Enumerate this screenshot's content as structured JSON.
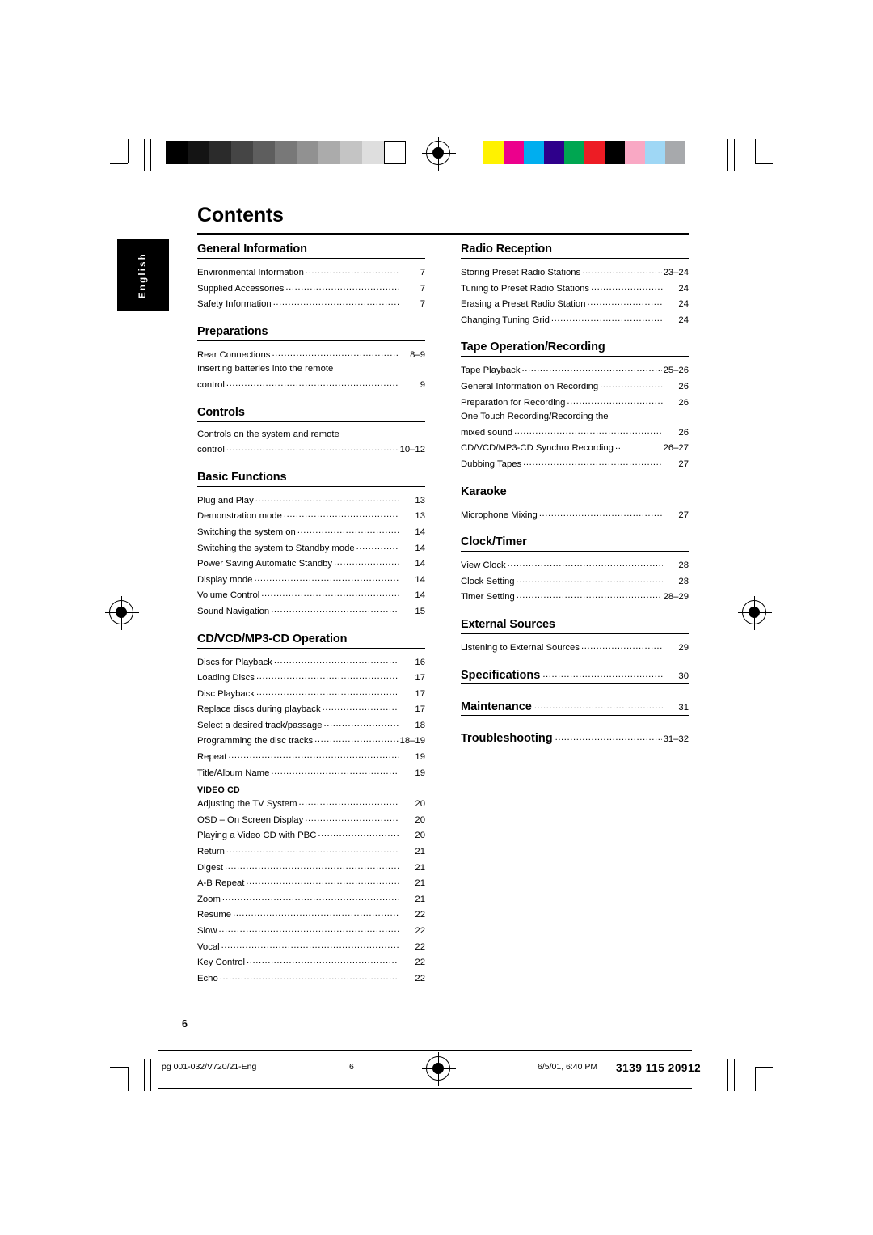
{
  "document": {
    "title": "Contents",
    "language_tab": "English",
    "page_number": "6"
  },
  "footer": {
    "file": "pg 001-032/V720/21-Eng",
    "page": "6",
    "date": "6/5/01, 6:40 PM",
    "code": "3139 115 20912"
  },
  "columns": {
    "left": [
      {
        "heading": "General Information",
        "entries": [
          {
            "text": "Environmental Information",
            "page": "7"
          },
          {
            "text": "Supplied Accessories",
            "page": "7"
          },
          {
            "text": "Safety Information",
            "page": "7"
          }
        ]
      },
      {
        "heading": "Preparations",
        "entries": [
          {
            "text": "Rear Connections",
            "page": "8–9"
          },
          {
            "text": "Inserting batteries into the remote",
            "page": "",
            "nodots": true
          },
          {
            "text": "control",
            "page": "9"
          }
        ]
      },
      {
        "heading": "Controls",
        "entries": [
          {
            "text": "Controls on the system and remote",
            "page": "",
            "nodots": true
          },
          {
            "text": "control",
            "page": "10–12"
          }
        ]
      },
      {
        "heading": "Basic Functions",
        "entries": [
          {
            "text": "Plug and Play",
            "page": "13"
          },
          {
            "text": "Demonstration mode",
            "page": "13"
          },
          {
            "text": "Switching the system on",
            "page": "14"
          },
          {
            "text": "Switching the system to Standby mode",
            "page": "14"
          },
          {
            "text": "Power Saving Automatic Standby",
            "page": "14"
          },
          {
            "text": "Display mode",
            "page": "14"
          },
          {
            "text": "Volume Control",
            "page": "14"
          },
          {
            "text": "Sound Navigation",
            "page": "15"
          }
        ]
      },
      {
        "heading": "CD/VCD/MP3-CD Operation",
        "entries": [
          {
            "text": "Discs for Playback",
            "page": "16"
          },
          {
            "text": "Loading Discs",
            "page": "17"
          },
          {
            "text": "Disc Playback",
            "page": "17"
          },
          {
            "text": "Replace discs during playback",
            "page": "17"
          },
          {
            "text": "Select a desired track/passage",
            "page": "18"
          },
          {
            "text": "Programming the disc tracks",
            "page": "18–19"
          },
          {
            "text": "Repeat",
            "page": "19"
          },
          {
            "text": "Title/Album Name",
            "page": "19"
          }
        ],
        "subhead": "VIDEO CD",
        "sub_entries": [
          {
            "text": "Adjusting the TV System",
            "page": "20"
          },
          {
            "text": "OSD – On Screen Display",
            "page": "20"
          },
          {
            "text": "Playing a Video CD with PBC",
            "page": "20"
          },
          {
            "text": "Return",
            "page": "21"
          },
          {
            "text": "Digest",
            "page": "21"
          },
          {
            "text": "A-B Repeat",
            "page": "21"
          },
          {
            "text": "Zoom",
            "page": "21"
          },
          {
            "text": "Resume",
            "page": "22"
          },
          {
            "text": "Slow",
            "page": "22"
          },
          {
            "text": "Vocal",
            "page": "22"
          },
          {
            "text": "Key Control",
            "page": "22"
          },
          {
            "text": "Echo",
            "page": "22"
          }
        ]
      }
    ],
    "right": [
      {
        "heading": "Radio Reception",
        "entries": [
          {
            "text": "Storing Preset Radio Stations",
            "page": "23–24"
          },
          {
            "text": "Tuning to Preset Radio Stations",
            "page": "24"
          },
          {
            "text": "Erasing a Preset Radio Station",
            "page": "24"
          },
          {
            "text": "Changing Tuning Grid",
            "page": "24"
          }
        ]
      },
      {
        "heading": "Tape Operation/Recording",
        "entries": [
          {
            "text": "Tape Playback",
            "page": "25–26"
          },
          {
            "text": "General Information on Recording",
            "page": "26"
          },
          {
            "text": "Preparation for Recording",
            "page": "26"
          },
          {
            "text": "One Touch Recording/Recording the",
            "page": "",
            "nodots": true
          },
          {
            "text": "mixed sound",
            "page": "26"
          },
          {
            "text": "CD/VCD/MP3-CD Synchro Recording",
            "page": "26–27"
          },
          {
            "text": "Dubbing Tapes",
            "page": "27"
          }
        ]
      },
      {
        "heading": "Karaoke",
        "entries": [
          {
            "text": "Microphone Mixing",
            "page": "27"
          }
        ]
      },
      {
        "heading": "Clock/Timer",
        "entries": [
          {
            "text": "View Clock",
            "page": "28"
          },
          {
            "text": "Clock Setting",
            "page": "28"
          },
          {
            "text": "Timer Setting",
            "page": "28–29"
          }
        ]
      },
      {
        "heading": "External Sources",
        "entries": [
          {
            "text": "Listening to External Sources",
            "page": "29"
          }
        ]
      },
      {
        "heading": "Specifications",
        "inline_page": "30",
        "entries": []
      },
      {
        "heading": "Maintenance",
        "inline_page": "31",
        "entries": []
      },
      {
        "heading": "Troubleshooting",
        "inline_page": "31–32",
        "entries": []
      }
    ]
  },
  "print_marks": {
    "gray_swatches": [
      "#000000",
      "#141414",
      "#2b2b2b",
      "#454545",
      "#5e5e5e",
      "#787878",
      "#919191",
      "#ababab",
      "#c4c4c4",
      "#dedede",
      "#ffffff"
    ],
    "color_swatches": [
      "#fff200",
      "#ec008c",
      "#00aeef",
      "#2e008b",
      "#00a651",
      "#ed1c24",
      "#000000",
      "#f9a8c4",
      "#9fd7f5",
      "#a7a9ac"
    ]
  }
}
